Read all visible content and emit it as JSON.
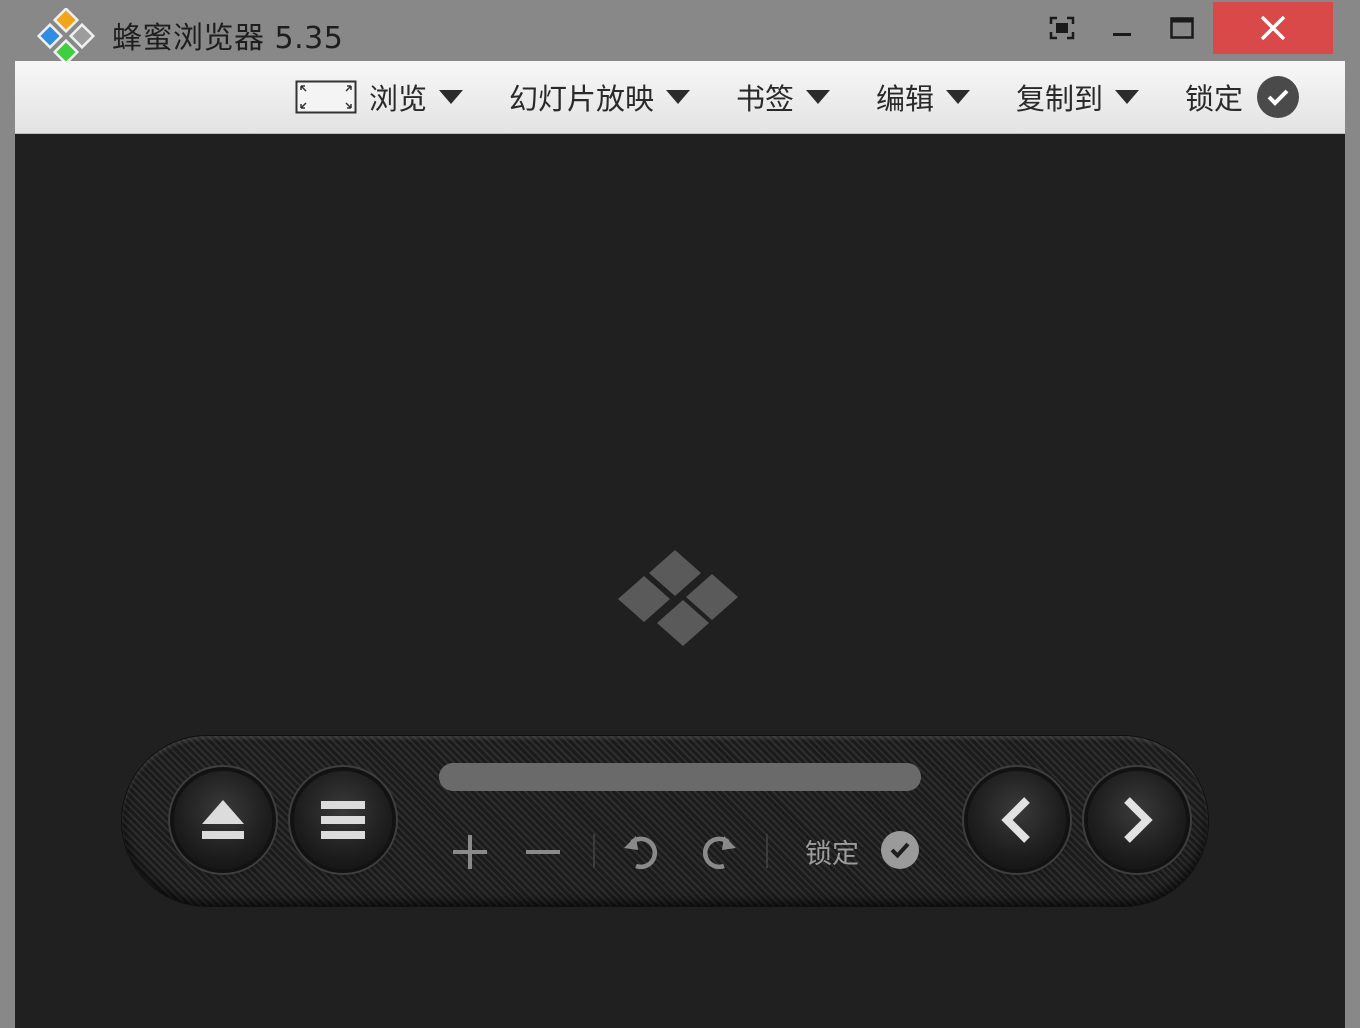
{
  "window": {
    "title": "蜂蜜浏览器 5.35",
    "controls": [
      "snap-icon",
      "minimize-icon",
      "maximize-icon",
      "close-icon"
    ],
    "close_color": "#d9494a"
  },
  "menu": {
    "items": [
      {
        "label": "浏览",
        "icon": "fit-screen-icon",
        "has_dropdown": true
      },
      {
        "label": "幻灯片放映",
        "has_dropdown": true
      },
      {
        "label": "书签",
        "has_dropdown": true
      },
      {
        "label": "编辑",
        "has_dropdown": true
      },
      {
        "label": "复制到",
        "has_dropdown": true
      },
      {
        "label": "锁定",
        "icon": "check-circle-icon",
        "has_dropdown": false
      }
    ]
  },
  "viewer": {
    "background": "#202020",
    "placeholder_icon": "app-logo-placeholder-icon"
  },
  "controls": {
    "left_buttons": [
      "eject-icon",
      "menu-icon"
    ],
    "right_buttons": [
      "previous-icon",
      "next-icon"
    ],
    "tools": [
      "zoom-in-icon",
      "zoom-out-icon",
      "rotate-left-icon",
      "rotate-right-icon"
    ],
    "progress": 1.0,
    "lock_label": "锁定",
    "lock_icon": "check-circle-icon"
  }
}
